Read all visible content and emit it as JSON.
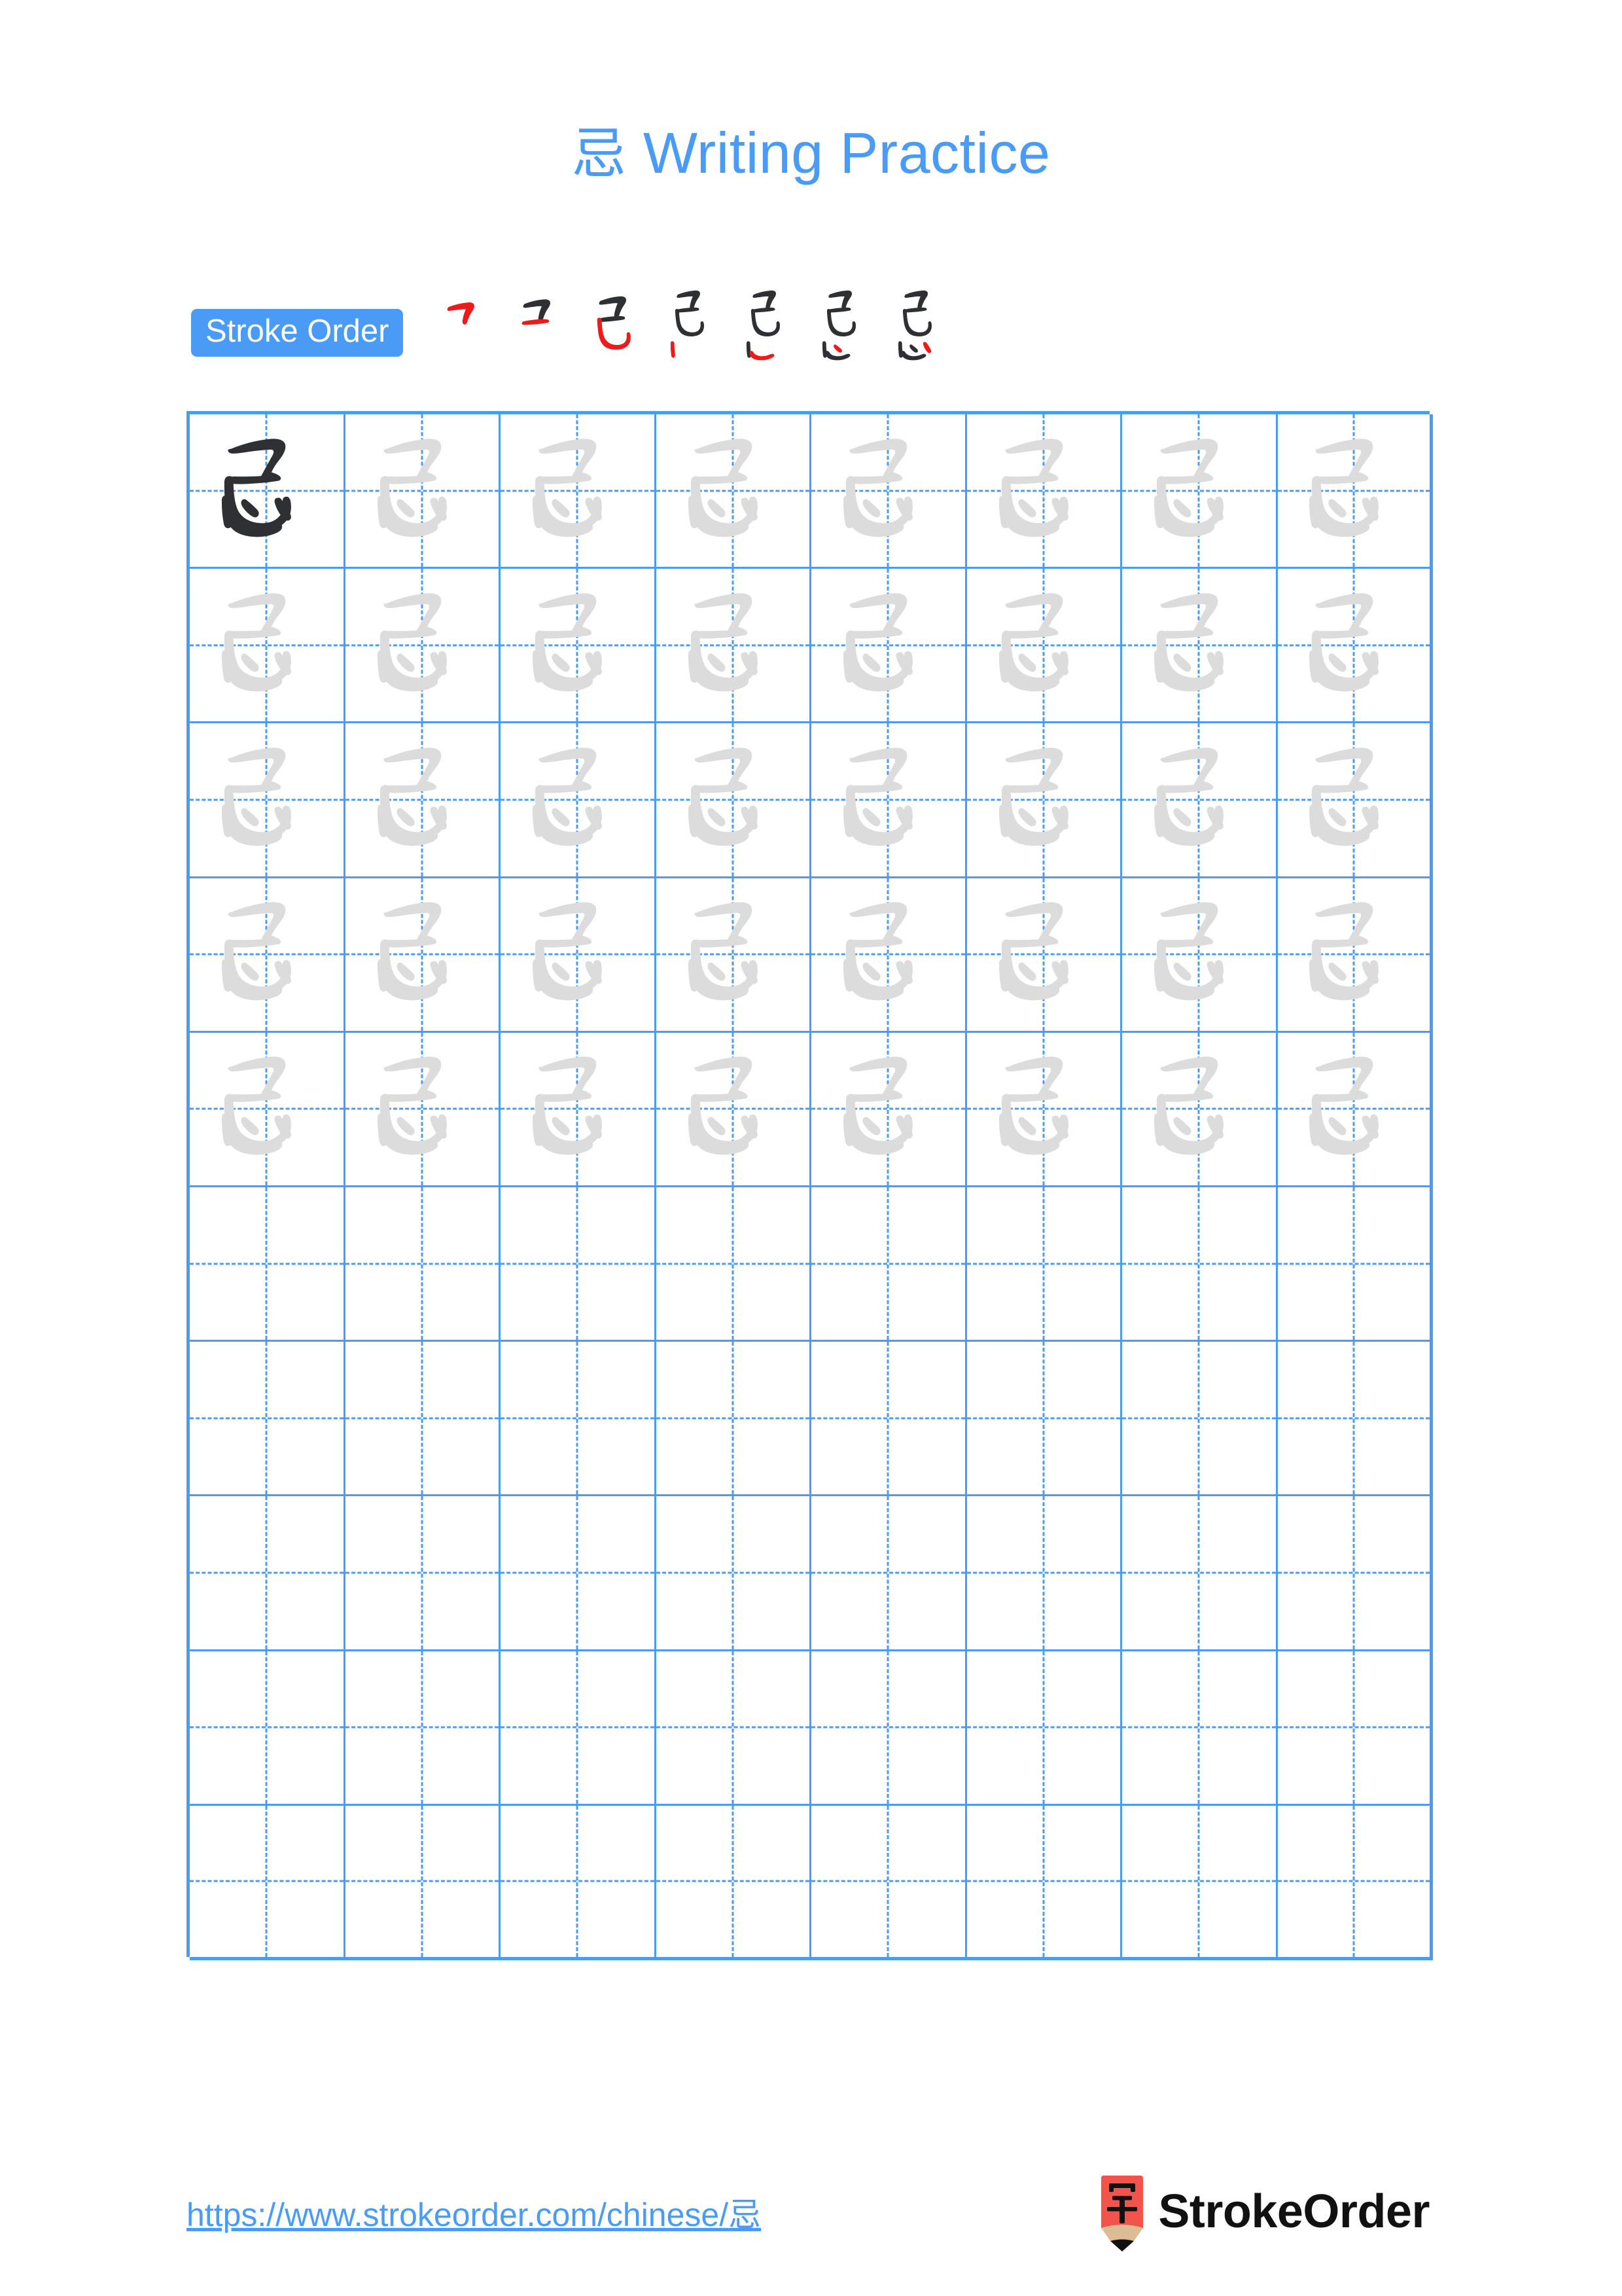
{
  "page": {
    "character": "忌",
    "title": "忌 Writing Practice",
    "title_character": "忌",
    "title_text": " Writing Practice",
    "background_color": "#ffffff",
    "accent_color": "#4a9bf5",
    "ink_dark_color": "#2e3033",
    "ink_trace_color": "#dcdcdc",
    "stroke_highlight_color": "#ee1b1b"
  },
  "stroke_order": {
    "badge_label": "Stroke Order",
    "badge_background": "#4a9bf5",
    "badge_text_color": "#ffffff",
    "stroke_count": 7,
    "steps": [
      {
        "index": 1,
        "new_stroke_color": "#ee1b1b",
        "prior_stroke_color": "#2e3033",
        "strokes_shown": 1
      },
      {
        "index": 2,
        "new_stroke_color": "#ee1b1b",
        "prior_stroke_color": "#2e3033",
        "strokes_shown": 2
      },
      {
        "index": 3,
        "new_stroke_color": "#ee1b1b",
        "prior_stroke_color": "#2e3033",
        "strokes_shown": 3
      },
      {
        "index": 4,
        "new_stroke_color": "#ee1b1b",
        "prior_stroke_color": "#2e3033",
        "strokes_shown": 4
      },
      {
        "index": 5,
        "new_stroke_color": "#ee1b1b",
        "prior_stroke_color": "#2e3033",
        "strokes_shown": 5
      },
      {
        "index": 6,
        "new_stroke_color": "#ee1b1b",
        "prior_stroke_color": "#2e3033",
        "strokes_shown": 6
      },
      {
        "index": 7,
        "new_stroke_color": "#ee1b1b",
        "prior_stroke_color": "#2e3033",
        "strokes_shown": 7
      }
    ]
  },
  "practice_grid": {
    "columns": 8,
    "rows": 10,
    "grid_line_color": "#4a9bf5",
    "rows_data": [
      {
        "row": 1,
        "cells": [
          "dark",
          "trace",
          "trace",
          "trace",
          "trace",
          "trace",
          "trace",
          "trace"
        ]
      },
      {
        "row": 2,
        "cells": [
          "trace",
          "trace",
          "trace",
          "trace",
          "trace",
          "trace",
          "trace",
          "trace"
        ]
      },
      {
        "row": 3,
        "cells": [
          "trace",
          "trace",
          "trace",
          "trace",
          "trace",
          "trace",
          "trace",
          "trace"
        ]
      },
      {
        "row": 4,
        "cells": [
          "trace",
          "trace",
          "trace",
          "trace",
          "trace",
          "trace",
          "trace",
          "trace"
        ]
      },
      {
        "row": 5,
        "cells": [
          "trace",
          "trace",
          "trace",
          "trace",
          "trace",
          "trace",
          "trace",
          "trace"
        ]
      },
      {
        "row": 6,
        "cells": [
          "empty",
          "empty",
          "empty",
          "empty",
          "empty",
          "empty",
          "empty",
          "empty"
        ]
      },
      {
        "row": 7,
        "cells": [
          "empty",
          "empty",
          "empty",
          "empty",
          "empty",
          "empty",
          "empty",
          "empty"
        ]
      },
      {
        "row": 8,
        "cells": [
          "empty",
          "empty",
          "empty",
          "empty",
          "empty",
          "empty",
          "empty",
          "empty"
        ]
      },
      {
        "row": 9,
        "cells": [
          "empty",
          "empty",
          "empty",
          "empty",
          "empty",
          "empty",
          "empty",
          "empty"
        ]
      },
      {
        "row": 10,
        "cells": [
          "empty",
          "empty",
          "empty",
          "empty",
          "empty",
          "empty",
          "empty",
          "empty"
        ]
      }
    ]
  },
  "footer": {
    "url": "https://www.strokeorder.com/chinese/忌",
    "url_prefix": "https://www.strokeorder.com/chinese/",
    "url_character": "忌",
    "url_color": "#4a9bf5",
    "brand_name": "StrokeOrder",
    "logo_character": "字",
    "logo_body_color": "#f2544b",
    "logo_wood_color": "#dcbc94",
    "logo_tip_color": "#111111"
  }
}
